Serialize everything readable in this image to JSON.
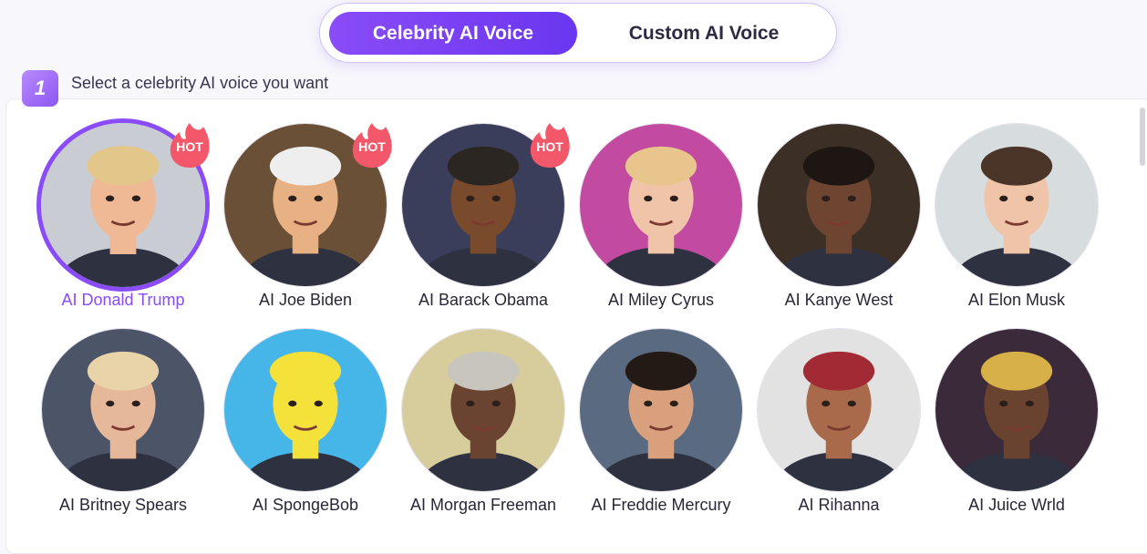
{
  "tabs": [
    {
      "label": "Celebrity AI Voice",
      "active": true
    },
    {
      "label": "Custom AI Voice",
      "active": false
    }
  ],
  "step": {
    "number": "1",
    "label": "Select a celebrity AI voice you want"
  },
  "hot_badge": "HOT",
  "colors": {
    "accent": "#8a4cf7",
    "hot": "#f2586a",
    "text": "#2a2638"
  },
  "voices": [
    {
      "name": "AI Donald Trump",
      "hot": true,
      "selected": true,
      "bg": "#c9cdd3",
      "skin": "#efb996",
      "hair": "#e2c68a"
    },
    {
      "name": "AI Joe Biden",
      "hot": true,
      "selected": false,
      "bg": "#6b5038",
      "skin": "#e8b184",
      "hair": "#eeeeee"
    },
    {
      "name": "AI Barack Obama",
      "hot": true,
      "selected": false,
      "bg": "#3a3e5a",
      "skin": "#7a4a2c",
      "hair": "#2b2622"
    },
    {
      "name": "AI Miley Cyrus",
      "hot": false,
      "selected": false,
      "bg": "#c24aa0",
      "skin": "#f0c4a8",
      "hair": "#e7c58c"
    },
    {
      "name": "AI Kanye West",
      "hot": false,
      "selected": false,
      "bg": "#3b2f26",
      "skin": "#6e4530",
      "hair": "#1e1612"
    },
    {
      "name": "AI Elon Musk",
      "hot": false,
      "selected": false,
      "bg": "#d7dcdf",
      "skin": "#efc4a8",
      "hair": "#4a3528"
    },
    {
      "name": "AI Britney Spears",
      "hot": false,
      "selected": false,
      "bg": "#4c5468",
      "skin": "#e6b89a",
      "hair": "#e9d3a8"
    },
    {
      "name": "AI SpongeBob",
      "hot": false,
      "selected": false,
      "bg": "#46b5e8",
      "skin": "#f4e13a",
      "hair": "#f4e13a"
    },
    {
      "name": "AI Morgan Freeman",
      "hot": false,
      "selected": false,
      "bg": "#d6cc9c",
      "skin": "#6a4430",
      "hair": "#c8c4be"
    },
    {
      "name": "AI Freddie Mercury",
      "hot": false,
      "selected": false,
      "bg": "#5a6a80",
      "skin": "#d9a07e",
      "hair": "#231a16"
    },
    {
      "name": "AI Rihanna",
      "hot": false,
      "selected": false,
      "bg": "#e2e2e2",
      "skin": "#a86a4a",
      "hair": "#a22a34"
    },
    {
      "name": "AI Juice Wrld",
      "hot": false,
      "selected": false,
      "bg": "#3a2a3a",
      "skin": "#6a4230",
      "hair": "#d8b048"
    }
  ]
}
